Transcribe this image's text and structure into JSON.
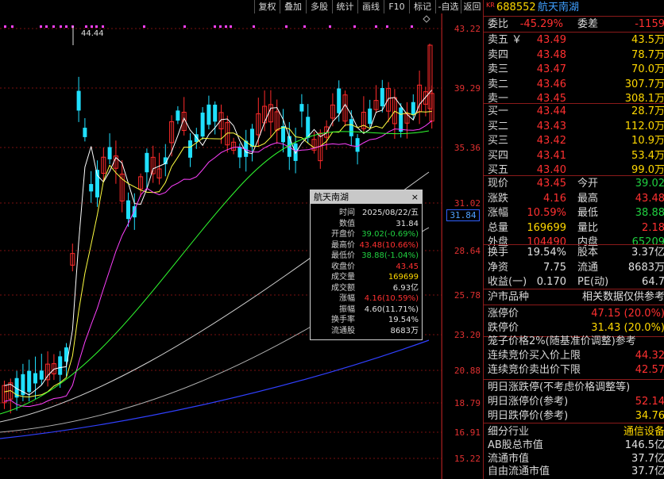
{
  "toolbar": {
    "items": [
      "复权",
      "叠加",
      "多股",
      "统计",
      "画线",
      "F10",
      "标记",
      "-自选",
      "返回"
    ]
  },
  "chart": {
    "peak_label": "44.44",
    "y_axis": [
      "43.22",
      "39.29",
      "35.36",
      "31.02",
      "28.64",
      "25.78",
      "23.20",
      "20.88",
      "18.79",
      "16.91",
      "15.22"
    ],
    "current_price_label": "31.84",
    "colors": {
      "up": "#ff2a2a",
      "down": "#20e0ff",
      "ma5": "#ffffff",
      "ma10": "#ffff40",
      "ma20": "#ff40ff",
      "ma60": "#30ff30",
      "ma120": "#d0d0d0",
      "ma250": "#3040ff"
    }
  },
  "popup": {
    "title": "航天南湖",
    "close": "×",
    "rows": [
      {
        "k": "时间",
        "v": "2025/08/22/五",
        "color": "#e0e0e0"
      },
      {
        "k": "数值",
        "v": "31.84",
        "color": "#e0e0e0"
      },
      {
        "k": "开盘价",
        "v": "39.02(-0.69%)",
        "color": "#20d040"
      },
      {
        "k": "最高价",
        "v": "43.48(10.66%)",
        "color": "#ff3030"
      },
      {
        "k": "最低价",
        "v": "38.88(-1.04%)",
        "color": "#20d040"
      },
      {
        "k": "收盘价",
        "v": "43.45",
        "color": "#ff3030"
      },
      {
        "k": "成交量",
        "v": "169699",
        "color": "#ffd800"
      },
      {
        "k": "成交额",
        "v": "6.93亿",
        "color": "#e0e0e0"
      },
      {
        "k": "涨幅",
        "v": "4.16(10.59%)",
        "color": "#ff3030"
      },
      {
        "k": "振幅",
        "v": "4.60(11.71%)",
        "color": "#e0e0e0"
      },
      {
        "k": "换手率",
        "v": "19.54%",
        "color": "#e0e0e0"
      },
      {
        "k": "流通股",
        "v": "8683万",
        "color": "#e0e0e0"
      }
    ]
  },
  "quote": {
    "market_tag": "KR",
    "code": "688552",
    "name": "航天南湖",
    "weibi_label": "委比",
    "weibi": "-45.29%",
    "weicha_label": "委差",
    "weicha": "-1159",
    "asks": [
      {
        "label": "卖五 ￥",
        "price": "43.49",
        "vol": "43.5万"
      },
      {
        "label": "卖四",
        "price": "43.48",
        "vol": "78.7万"
      },
      {
        "label": "卖三",
        "price": "43.47",
        "vol": "70.0万"
      },
      {
        "label": "卖二",
        "price": "43.46",
        "vol": "307.7万"
      },
      {
        "label": "卖一",
        "price": "43.45",
        "vol": "308.1万"
      }
    ],
    "bids": [
      {
        "label": "买一",
        "price": "43.44",
        "vol": "28.7万"
      },
      {
        "label": "买二",
        "price": "43.43",
        "vol": "112.0万"
      },
      {
        "label": "买三",
        "price": "43.42",
        "vol": "10.9万"
      },
      {
        "label": "买四",
        "price": "43.41",
        "vol": "53.4万"
      },
      {
        "label": "买五",
        "price": "43.40",
        "vol": "99.0万"
      }
    ],
    "stats": [
      {
        "a": "现价",
        "b": "43.45",
        "bc": "red",
        "c": "今开",
        "d": "39.02",
        "dc": "grn"
      },
      {
        "a": "涨跌",
        "b": "4.16",
        "bc": "red",
        "c": "最高",
        "d": "43.48",
        "dc": "red"
      },
      {
        "a": "涨幅",
        "b": "10.59%",
        "bc": "red",
        "c": "最低",
        "d": "38.88",
        "dc": "grn"
      },
      {
        "a": "总量",
        "b": "169699",
        "bc": "yel",
        "c": "量比",
        "d": "2.18",
        "dc": "red"
      },
      {
        "a": "外盘",
        "b": "104490",
        "bc": "red",
        "c": "内盘",
        "d": "65209",
        "dc": "grn"
      }
    ],
    "stats2": [
      {
        "a": "换手",
        "b": "19.54%",
        "bc": "wht",
        "c": "股本",
        "d": "3.37亿",
        "dc": "wht"
      },
      {
        "a": "净资",
        "b": "7.75",
        "bc": "wht",
        "c": "流通",
        "d": "8683万",
        "dc": "wht"
      },
      {
        "a": "收益(一)",
        "b": "0.170",
        "bc": "wht",
        "c": "PE(动)",
        "d": "64.7",
        "dc": "wht"
      }
    ],
    "market_kind": "沪市品种",
    "data_note": "相关数据仅供参考",
    "limit_up_label": "涨停价",
    "limit_up": "47.15 (20.0%)",
    "limit_down_label": "跌停价",
    "limit_down": "31.43 (20.0%)",
    "cage_note": "笼子价格2%(随基准价调整)参考",
    "auction_buy_label": "连续竞价买入价上限",
    "auction_buy": "44.32",
    "auction_sell_label": "连续竞价卖出价下限",
    "auction_sell": "42.57",
    "tomorrow_note": "明日涨跌停(不考虑价格调整等)",
    "tm_up_label": "明日涨停价(参考)",
    "tm_up": "52.14",
    "tm_down_label": "明日跌停价(参考)",
    "tm_down": "34.76",
    "industry_label": "细分行业",
    "industry": "通信设备",
    "ab_cap_label": "AB股总市值",
    "ab_cap": "146.5亿",
    "float_cap_label": "流通市值",
    "float_cap": "37.7亿",
    "free_cap_label": "自由流通市值",
    "free_cap": "37.7亿"
  }
}
